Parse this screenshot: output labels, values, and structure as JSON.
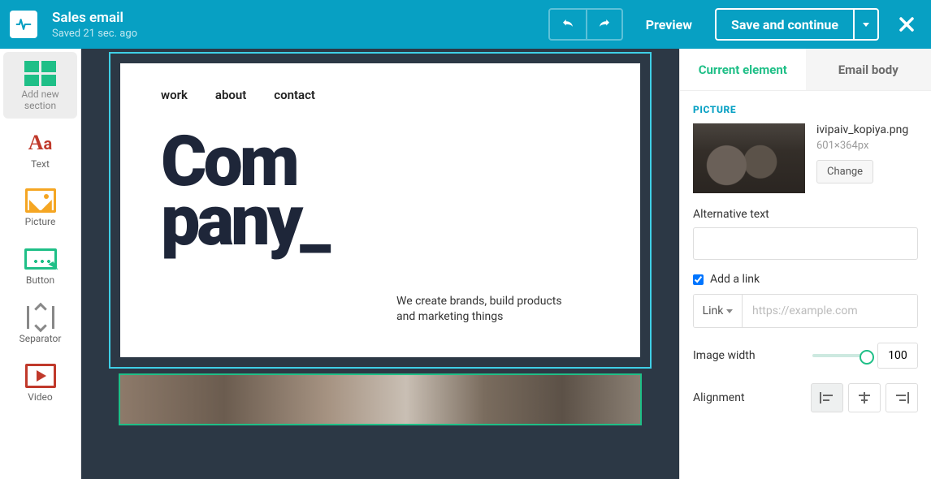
{
  "header": {
    "title": "Sales email",
    "saved": "Saved 21 sec. ago",
    "preview": "Preview",
    "save": "Save and continue"
  },
  "sidebar": {
    "items": [
      {
        "label": "Add new section"
      },
      {
        "label": "Text"
      },
      {
        "label": "Picture"
      },
      {
        "label": "Button"
      },
      {
        "label": "Separator"
      },
      {
        "label": "Video"
      }
    ]
  },
  "canvas": {
    "nav": {
      "work": "work",
      "about": "about",
      "contact": "contact"
    },
    "logo_line1": "Com",
    "logo_line2": "pany_",
    "tagline": "We create brands, build products and marketing things"
  },
  "panel": {
    "tabs": {
      "current": "Current element",
      "body": "Email body"
    },
    "section": "PICTURE",
    "file": {
      "name": "ivipaiv_kopiya.png",
      "dims": "601×364px",
      "change": "Change"
    },
    "alt_label": "Alternative text",
    "alt_value": "",
    "link": {
      "checkbox": "Add a link",
      "checked": true,
      "type": "Link",
      "placeholder": "https://example.com",
      "value": ""
    },
    "width": {
      "label": "Image width",
      "value": "100"
    },
    "align": {
      "label": "Alignment",
      "value": "left"
    }
  }
}
